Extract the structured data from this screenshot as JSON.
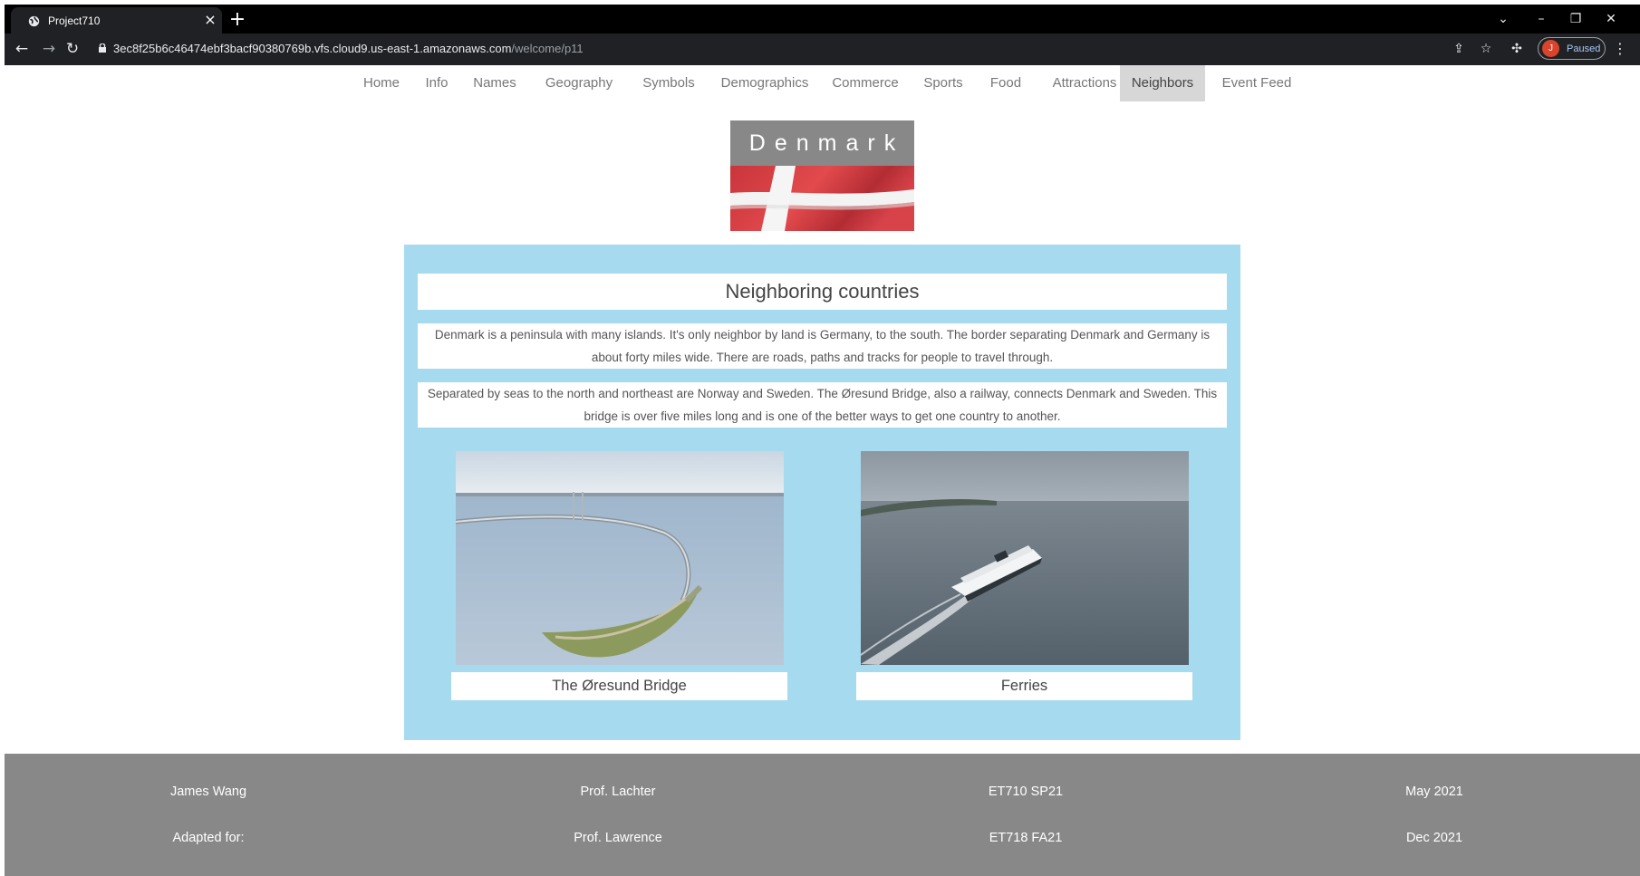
{
  "browser": {
    "tab_title": "Project710",
    "url_host": "3ec8f25b6c46474ebf3bacf90380769b.vfs.cloud9.us-east-1.amazonaws.com",
    "url_path": "/welcome/p11",
    "profile_initial": "J",
    "profile_status": "Paused"
  },
  "nav": {
    "items": [
      {
        "label": "Home"
      },
      {
        "label": "Info"
      },
      {
        "label": "Names"
      },
      {
        "label": "Geography"
      },
      {
        "label": "Symbols"
      },
      {
        "label": "Demographics"
      },
      {
        "label": "Commerce"
      },
      {
        "label": "Sports"
      },
      {
        "label": "Food"
      },
      {
        "label": "Attractions"
      },
      {
        "label": "Neighbors",
        "active": true
      },
      {
        "label": "Event Feed"
      }
    ]
  },
  "header": {
    "country": "Denmark"
  },
  "main": {
    "title": "Neighboring countries",
    "paragraphs": [
      "Denmark is a peninsula with many islands. It's only neighbor by land is Germany, to the south. The border separating Denmark and Germany is about forty miles wide. There are roads, paths and tracks for people to travel through.",
      "Separated by seas to the north and northeast are Norway and Sweden. The Øresund Bridge, also a railway, connects Denmark and Sweden. This bridge is over five miles long and is one of the better ways to get one country to another."
    ],
    "images": [
      {
        "caption": "The Øresund Bridge"
      },
      {
        "caption": "Ferries"
      }
    ]
  },
  "footer": {
    "rows": [
      [
        "James Wang",
        "Prof. Lachter",
        "ET710 SP21",
        "May 2021"
      ],
      [
        "Adapted for:",
        "Prof. Lawrence",
        "ET718 FA21",
        "Dec 2021"
      ]
    ]
  },
  "colors": {
    "panel": "#a6daef",
    "footer": "#888888",
    "active_nav": "#d7d7d7",
    "chrome": "#202124"
  }
}
